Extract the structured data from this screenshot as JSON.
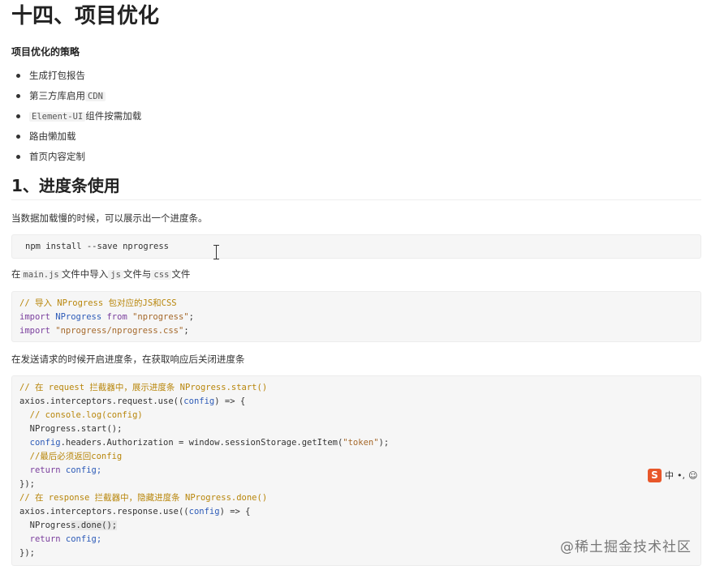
{
  "heading_main": "十四、项目优化",
  "strategy_title": "项目优化的策略",
  "strategies": [
    {
      "pre": "生成打包报告",
      "code": "",
      "post": ""
    },
    {
      "pre": "第三方库启用",
      "code": "CDN",
      "post": ""
    },
    {
      "pre": "",
      "code": "Element-UI",
      "post": "组件按需加载"
    },
    {
      "pre": "路由懒加载",
      "code": "",
      "post": ""
    },
    {
      "pre": "首页内容定制",
      "code": "",
      "post": ""
    }
  ],
  "section_title": "1、进度条使用",
  "para1": "当数据加载慢的时候，可以展示出一个进度条。",
  "install_cmd": "npm install --save nprogress",
  "para2": {
    "p1": "在",
    "c1": "main.js",
    "p2": "文件中导入",
    "c2": "js",
    "p3": "文件与",
    "c3": "css",
    "p4": "文件"
  },
  "import_code": {
    "l1": "// 导入 NProgress 包对应的JS和CSS",
    "l2_kw": "import",
    "l2_id": " NProgress ",
    "l2_from": "from",
    "l2_str": " \"nprogress\"",
    "l2_end": ";",
    "l3_kw": "import",
    "l3_str": " \"nprogress/nprogress.css\"",
    "l3_end": ";"
  },
  "para3": "在发送请求的时候开启进度条，在获取响应后关闭进度条",
  "interceptor_code": {
    "l1": "// 在 request 拦截器中，展示进度条 NProgress.start()",
    "l2a": "axios.interceptors.request.use((",
    "l2b": "config",
    "l2c": ") => {",
    "l3": "  // console.log(config)",
    "l4": "  NProgress.start();",
    "l5a": "  ",
    "l5b": "config",
    "l5c": ".headers.Authorization = window.sessionStorage.getItem(",
    "l5d": "\"token\"",
    "l5e": ");",
    "l6": "  //最后必须返回config",
    "l7a": "  ",
    "l7b": "return",
    "l7c": " config;",
    "l8": "});",
    "l9": "// 在 response 拦截器中，隐藏进度条 NProgress.done()",
    "l10a": "axios.interceptors.response.use((",
    "l10b": "config",
    "l10c": ") => {",
    "l11a": "  NProgres",
    "l11b": "s.done();",
    "l12a": "  ",
    "l12b": "return",
    "l12c": " config;",
    "l13": "});"
  },
  "ime": {
    "logo": "S",
    "lang": "中",
    "extra": "•,"
  },
  "watermark": "@稀土掘金技术社区"
}
